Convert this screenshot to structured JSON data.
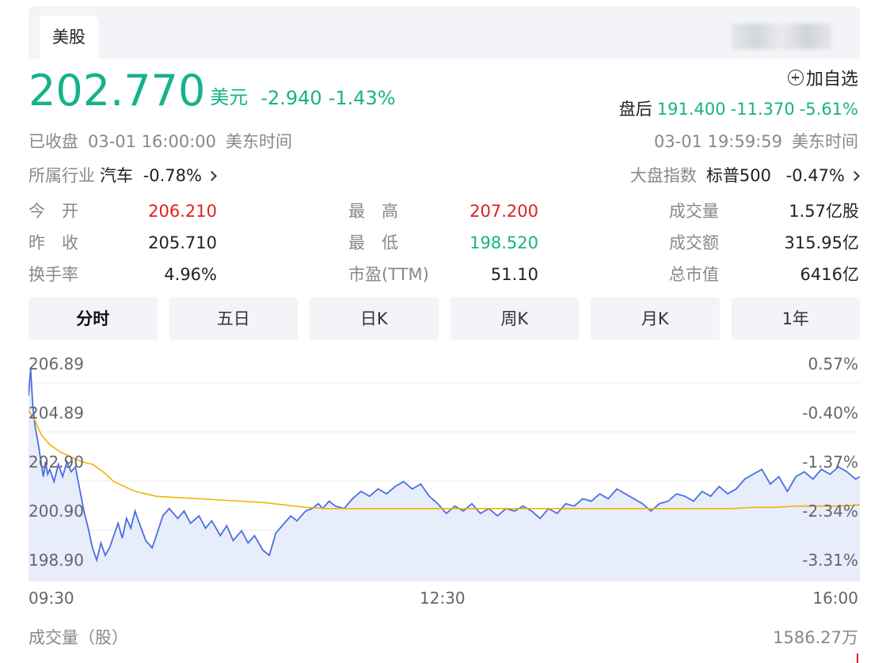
{
  "market_tab": "美股",
  "quote": {
    "price": "202.770",
    "currency": "美元",
    "change": "-2.940",
    "change_pct": "-1.43%",
    "watch_label": "加自选",
    "after_label": "盘后",
    "after_price": "191.400",
    "after_change": "-11.370",
    "after_pct": "-5.61%",
    "status": "已收盘",
    "close_time": "03-01 16:00:00",
    "tz": "美东时间",
    "after_time": "03-01 19:59:59",
    "after_tz": "美东时间",
    "industry_label": "所属行业",
    "industry_name": "汽车",
    "industry_pct": "-0.78%",
    "index_label": "大盘指数",
    "index_name": "标普500",
    "index_pct": "-0.47%"
  },
  "stats": [
    {
      "label": "今　开",
      "value": "206.210",
      "color": "red"
    },
    {
      "label": "最　高",
      "value": "207.200",
      "color": "red"
    },
    {
      "label": "成交量",
      "value": "1.57亿股",
      "color": ""
    },
    {
      "label": "昨　收",
      "value": "205.710",
      "color": ""
    },
    {
      "label": "最　低",
      "value": "198.520",
      "color": "green"
    },
    {
      "label": "成交额",
      "value": "315.95亿",
      "color": ""
    },
    {
      "label": "换手率",
      "value": "4.96%",
      "color": ""
    },
    {
      "label": "市盈(TTM)",
      "value": "51.10",
      "color": ""
    },
    {
      "label": "总市值",
      "value": "6416亿",
      "color": ""
    }
  ],
  "period_tabs": [
    "分时",
    "五日",
    "日K",
    "周K",
    "月K",
    "1年"
  ],
  "volume": {
    "label": "成交量（股）",
    "value": "1586.27万"
  },
  "chart_data": {
    "type": "line",
    "y_left_ticks": [
      "206.89",
      "204.89",
      "202.90",
      "200.90",
      "198.90"
    ],
    "y_right_ticks": [
      "0.57%",
      "-0.40%",
      "-1.37%",
      "-2.34%",
      "-3.31%"
    ],
    "x_ticks": [
      "09:30",
      "12:30",
      "16:00"
    ],
    "ylim": [
      198.9,
      206.89
    ],
    "xlim": [
      0,
      390
    ],
    "colors": {
      "price": "#4a6fe0",
      "avg": "#f0b400",
      "fill": "#e8edfc"
    },
    "series": [
      {
        "name": "price",
        "x": [
          0,
          1,
          2,
          3,
          4,
          5,
          6,
          7,
          8,
          9,
          10,
          12,
          14,
          16,
          18,
          20,
          22,
          24,
          26,
          28,
          30,
          32,
          34,
          36,
          38,
          40,
          42,
          44,
          46,
          48,
          50,
          52,
          55,
          58,
          60,
          63,
          66,
          70,
          73,
          76,
          80,
          83,
          86,
          90,
          93,
          96,
          100,
          103,
          106,
          110,
          113,
          116,
          120,
          123,
          126,
          130,
          133,
          136,
          138,
          141,
          144,
          148,
          152,
          156,
          160,
          164,
          168,
          172,
          176,
          180,
          184,
          188,
          192,
          196,
          200,
          204,
          208,
          212,
          216,
          220,
          224,
          228,
          232,
          236,
          240,
          244,
          248,
          252,
          256,
          260,
          264,
          268,
          272,
          276,
          280,
          284,
          288,
          292,
          296,
          300,
          304,
          308,
          312,
          316,
          320,
          324,
          328,
          332,
          336,
          340,
          344,
          348,
          352,
          356,
          360,
          364,
          368,
          372,
          376,
          380,
          384,
          388,
          390
        ],
        "y": [
          205.6,
          206.7,
          205.2,
          204.4,
          203.9,
          203.4,
          202.8,
          202.3,
          202.9,
          202.4,
          202.6,
          202.1,
          202.8,
          202.3,
          202.9,
          202.5,
          202.7,
          201.8,
          200.9,
          200.2,
          199.4,
          198.9,
          199.6,
          199.1,
          199.4,
          199.9,
          200.4,
          199.8,
          200.6,
          200.2,
          200.9,
          200.4,
          199.7,
          199.4,
          199.9,
          200.7,
          201.0,
          200.6,
          200.9,
          200.4,
          200.7,
          200.2,
          200.5,
          199.9,
          200.3,
          199.7,
          200.1,
          199.6,
          199.9,
          199.3,
          199.1,
          200.0,
          200.4,
          200.7,
          200.5,
          200.9,
          201.0,
          201.2,
          201.0,
          201.3,
          201.1,
          201.0,
          201.4,
          201.7,
          201.5,
          201.8,
          201.6,
          201.9,
          202.1,
          201.8,
          202.0,
          201.5,
          201.2,
          200.8,
          201.1,
          200.9,
          201.2,
          200.8,
          201.0,
          200.7,
          201.0,
          200.9,
          201.1,
          200.9,
          200.6,
          201.0,
          200.8,
          201.2,
          201.1,
          201.4,
          201.3,
          201.6,
          201.4,
          201.8,
          201.6,
          201.4,
          201.2,
          200.9,
          201.2,
          201.3,
          201.6,
          201.5,
          201.3,
          201.7,
          201.5,
          201.9,
          201.6,
          201.8,
          202.2,
          202.4,
          202.6,
          202.0,
          202.3,
          201.7,
          202.3,
          202.5,
          202.2,
          202.6,
          202.4,
          202.7,
          202.5,
          202.2,
          202.3
        ]
      },
      {
        "name": "avg",
        "x": [
          0,
          3,
          6,
          10,
          15,
          20,
          25,
          30,
          35,
          40,
          45,
          50,
          55,
          60,
          70,
          80,
          90,
          100,
          110,
          120,
          130,
          140,
          150,
          160,
          170,
          180,
          190,
          200,
          210,
          220,
          230,
          240,
          250,
          260,
          270,
          280,
          290,
          300,
          310,
          320,
          330,
          340,
          350,
          360,
          370,
          380,
          390
        ],
        "y": [
          205.0,
          204.6,
          204.0,
          203.6,
          203.3,
          203.1,
          202.9,
          202.8,
          202.5,
          202.1,
          201.9,
          201.7,
          201.6,
          201.5,
          201.45,
          201.4,
          201.35,
          201.3,
          201.25,
          201.15,
          201.05,
          201.0,
          201.0,
          201.0,
          201.0,
          201.0,
          201.0,
          201.0,
          201.0,
          201.0,
          201.0,
          201.0,
          201.0,
          201.0,
          201.0,
          201.0,
          201.0,
          201.0,
          201.0,
          201.0,
          201.0,
          201.05,
          201.05,
          201.1,
          201.1,
          201.1,
          201.15
        ]
      }
    ]
  }
}
